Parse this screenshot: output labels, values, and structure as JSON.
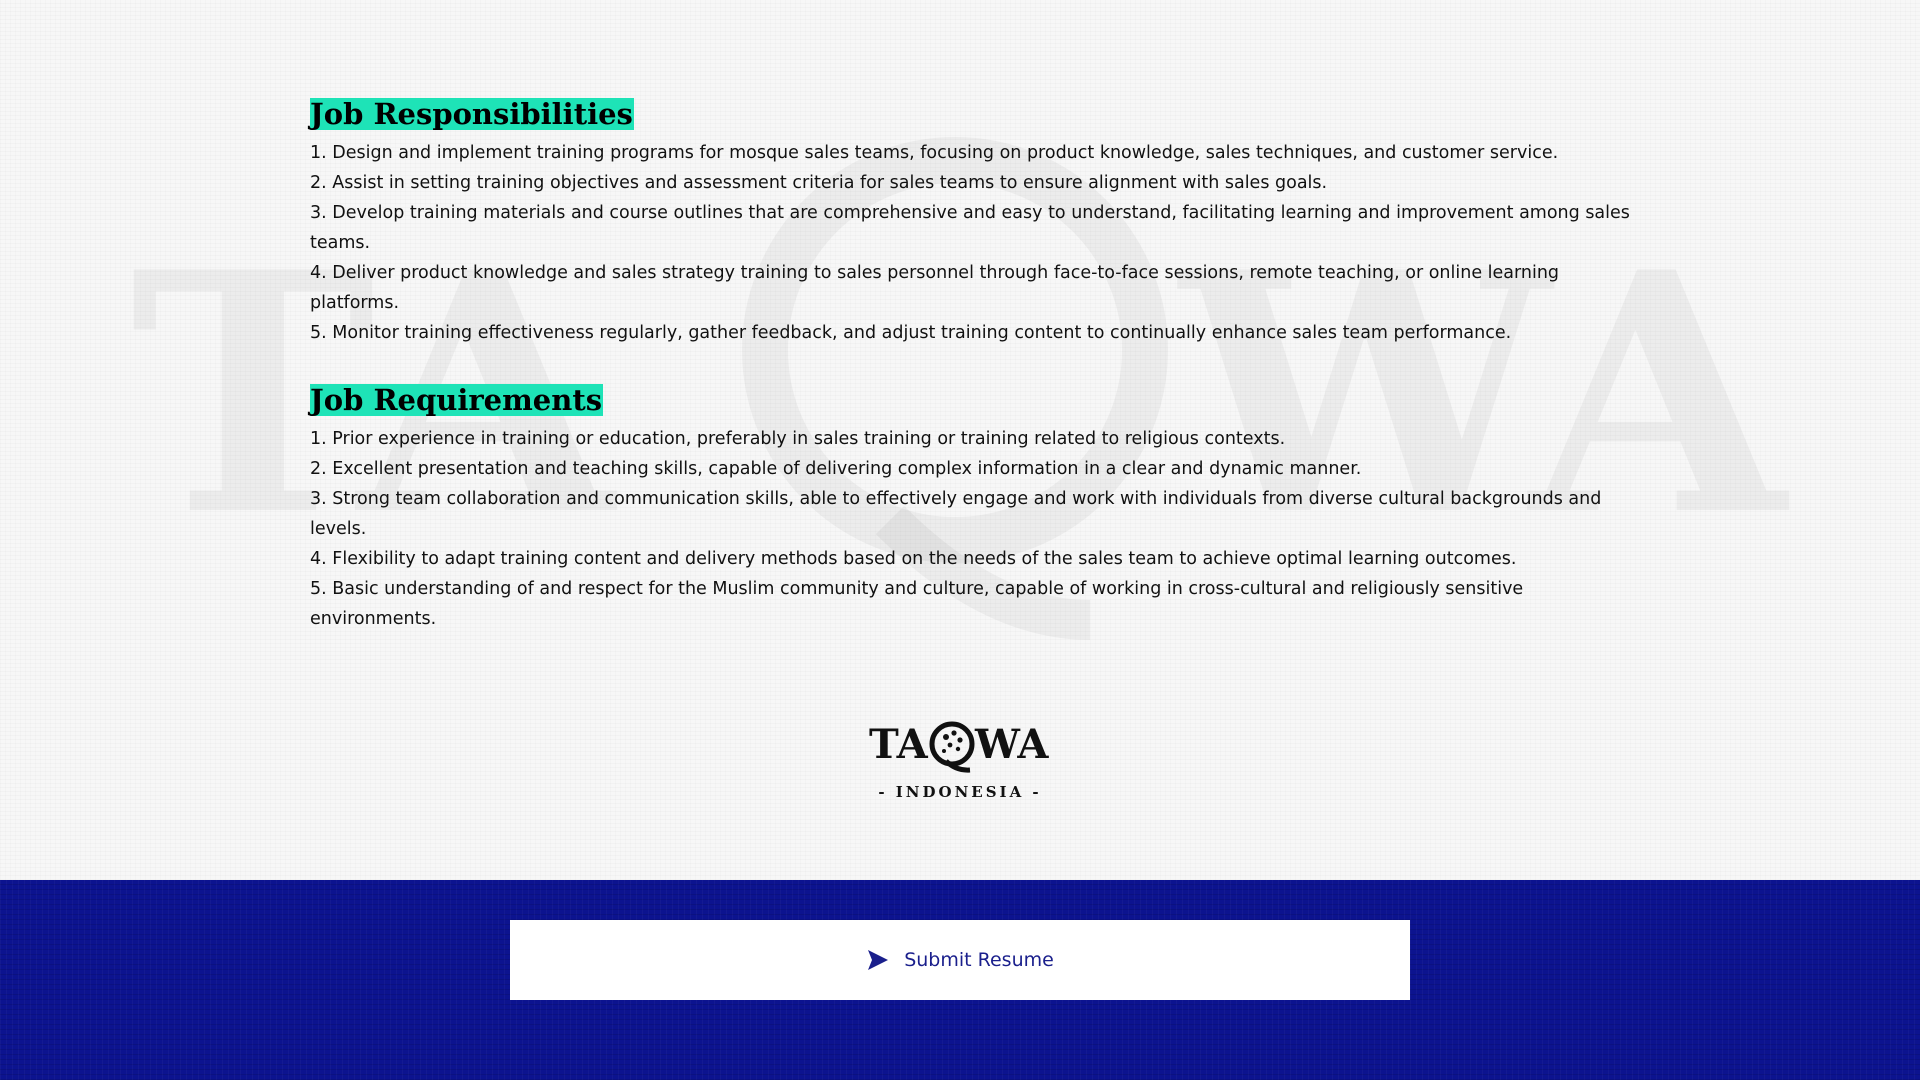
{
  "colors": {
    "highlight": "#1ee3b7",
    "footer_bg": "#0c138f",
    "button_bg": "#ffffff",
    "button_text": "#1a1f8c"
  },
  "responsibilities": {
    "title": "Job Responsibilities",
    "items": [
      "1. Design and implement training programs for mosque sales teams, focusing on product knowledge, sales techniques, and customer service.",
      "2. Assist in setting training objectives and assessment criteria for sales teams to ensure alignment with sales goals.",
      "3. Develop training materials and course outlines that are comprehensive and easy to understand, facilitating learning and improvement among sales teams.",
      "4. Deliver product knowledge and sales strategy training to sales personnel through face-to-face sessions, remote teaching, or online learning platforms.",
      "5. Monitor training effectiveness regularly, gather feedback, and adjust training content to continually enhance sales team performance."
    ]
  },
  "requirements": {
    "title": "Job Requirements",
    "items": [
      "1. Prior experience in training or education, preferably in sales training or training related to religious contexts.",
      "2. Excellent presentation and teaching skills, capable of delivering complex information in a clear and dynamic manner.",
      "3. Strong team collaboration and communication skills, able to effectively engage and work with individuals from diverse cultural backgrounds and levels.",
      "4. Flexibility to adapt training content and delivery methods based on the needs of the sales team to achieve optimal learning outcomes.",
      "5. Basic understanding of and respect for the Muslim community and culture, capable of working in cross-cultural and religiously sensitive environments."
    ]
  },
  "logo": {
    "wordmark": "TAQWA",
    "subtitle": "- INDONESIA -"
  },
  "footer": {
    "submit_label": "Submit Resume",
    "submit_icon": "send-icon"
  }
}
